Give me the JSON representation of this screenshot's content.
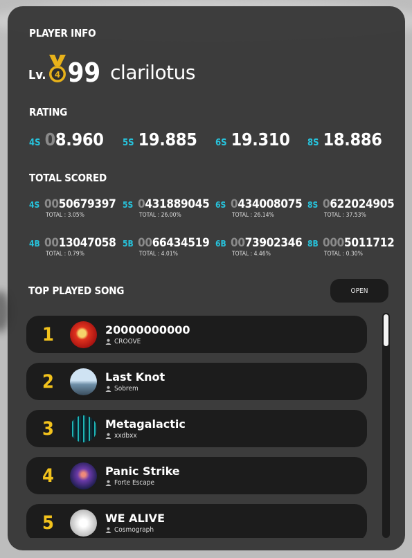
{
  "player_info": {
    "title": "PLAYER INFO",
    "level_label": "Lv.",
    "level": "99",
    "player_name": "clarilotus"
  },
  "rating": {
    "title": "RATING",
    "items": [
      {
        "key": "4S",
        "prefix": "0",
        "value": "8.960"
      },
      {
        "key": "5S",
        "prefix": "",
        "value": "19.885"
      },
      {
        "key": "6S",
        "prefix": "",
        "value": "19.310"
      },
      {
        "key": "8S",
        "prefix": "",
        "value": "18.886"
      }
    ]
  },
  "total_scored": {
    "title": "TOTAL SCORED",
    "items": [
      {
        "key": "4S",
        "prefix": "00",
        "value": "50679397",
        "total": "TOTAL : 3.05%"
      },
      {
        "key": "5S",
        "prefix": "0",
        "value": "431889045",
        "total": "TOTAL : 26.00%"
      },
      {
        "key": "6S",
        "prefix": "0",
        "value": "434008075",
        "total": "TOTAL : 26.14%"
      },
      {
        "key": "8S",
        "prefix": "0",
        "value": "622024905",
        "total": "TOTAL : 37.53%"
      },
      {
        "key": "4B",
        "prefix": "00",
        "value": "13047058",
        "total": "TOTAL : 0.79%"
      },
      {
        "key": "5B",
        "prefix": "00",
        "value": "66434519",
        "total": "TOTAL : 4.01%"
      },
      {
        "key": "6B",
        "prefix": "00",
        "value": "73902346",
        "total": "TOTAL : 4.46%"
      },
      {
        "key": "8B",
        "prefix": "000",
        "value": "5011712",
        "total": "TOTAL : 0.30%"
      }
    ]
  },
  "top_played": {
    "title": "TOP PLAYED SONG",
    "open_label": "OPEN",
    "songs": [
      {
        "rank": "1",
        "title": "20000000000",
        "artist": "CROOVE"
      },
      {
        "rank": "2",
        "title": "Last Knot",
        "artist": "Sobrem"
      },
      {
        "rank": "3",
        "title": "Metagalactic",
        "artist": "xxdbxx"
      },
      {
        "rank": "4",
        "title": "Panic Strike",
        "artist": "Forte Escape"
      },
      {
        "rank": "5",
        "title": "WE ALIVE",
        "artist": "Cosmograph"
      }
    ]
  },
  "colors": {
    "accent": "#27c3dc",
    "rank": "#f2c21c",
    "medal": "#e8b21a"
  }
}
